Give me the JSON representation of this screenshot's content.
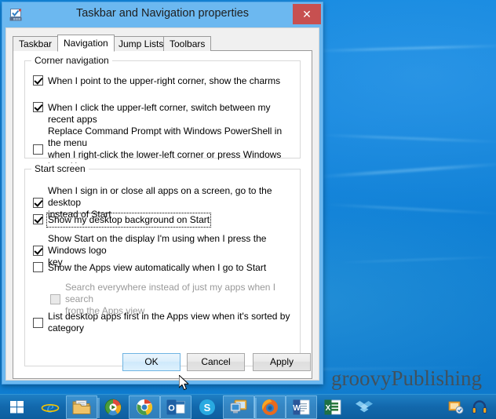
{
  "window": {
    "title": "Taskbar and Navigation properties",
    "icon": "taskbar-properties-icon",
    "close_label": "✕",
    "accent_titlebar": "#6cb8f0",
    "close_color": "#c75050"
  },
  "tabs": [
    {
      "label": "Taskbar",
      "selected": false
    },
    {
      "label": "Navigation",
      "selected": true
    },
    {
      "label": "Jump Lists",
      "selected": false
    },
    {
      "label": "Toolbars",
      "selected": false
    }
  ],
  "groups": {
    "corner_navigation": {
      "legend": "Corner navigation",
      "options": [
        {
          "label": "When I point to the upper-right corner, show the charms",
          "checked": true,
          "enabled": true,
          "focused": false
        },
        {
          "label": "When I click the upper-left corner, switch between my recent apps",
          "checked": true,
          "enabled": true,
          "focused": false
        },
        {
          "label": "Replace Command Prompt with Windows PowerShell in the menu\nwhen I right-click the lower-left corner or press Windows key +X",
          "checked": false,
          "enabled": true,
          "focused": false
        }
      ]
    },
    "start_screen": {
      "legend": "Start screen",
      "options": [
        {
          "label": "When I sign in or close all apps on a screen, go to the desktop\ninstead of Start",
          "checked": true,
          "enabled": true,
          "focused": false
        },
        {
          "label": "Show my desktop background on Start",
          "checked": true,
          "enabled": true,
          "focused": true
        },
        {
          "label": "Show Start on the display I'm using when I press the Windows logo\nkey",
          "checked": true,
          "enabled": true,
          "focused": false
        },
        {
          "label": "Show the Apps view automatically when I go to Start",
          "checked": false,
          "enabled": true,
          "focused": false
        },
        {
          "label": "Search everywhere instead of just my apps when I search\nfrom the Apps view",
          "checked": false,
          "enabled": false,
          "focused": false
        },
        {
          "label": "List desktop apps first in the Apps view when it's sorted by\ncategory",
          "checked": false,
          "enabled": true,
          "focused": false
        }
      ]
    }
  },
  "buttons": {
    "ok": "OK",
    "cancel": "Cancel",
    "apply": "Apply"
  },
  "desktop": {
    "watermark": "groovyPublishing"
  },
  "taskbar": {
    "items": [
      {
        "name": "start-button",
        "running": false,
        "multi": false
      },
      {
        "name": "internet-explorer-icon",
        "running": false,
        "multi": false
      },
      {
        "name": "file-explorer-icon",
        "running": true,
        "multi": true
      },
      {
        "name": "windows-media-player-icon",
        "running": false,
        "multi": false
      },
      {
        "name": "google-chrome-icon",
        "running": true,
        "multi": false
      },
      {
        "name": "outlook-icon",
        "running": true,
        "multi": false
      },
      {
        "name": "skype-icon",
        "running": false,
        "multi": false
      },
      {
        "name": "remote-desktop-icon",
        "running": true,
        "multi": true
      },
      {
        "name": "firefox-icon",
        "running": true,
        "multi": false
      },
      {
        "name": "word-icon",
        "running": true,
        "multi": false
      },
      {
        "name": "excel-icon",
        "running": false,
        "multi": false
      },
      {
        "name": "dropbox-icon",
        "running": false,
        "multi": false
      }
    ],
    "tray": [
      {
        "name": "tray-notification-icon"
      },
      {
        "name": "tray-headphones-icon"
      }
    ]
  }
}
